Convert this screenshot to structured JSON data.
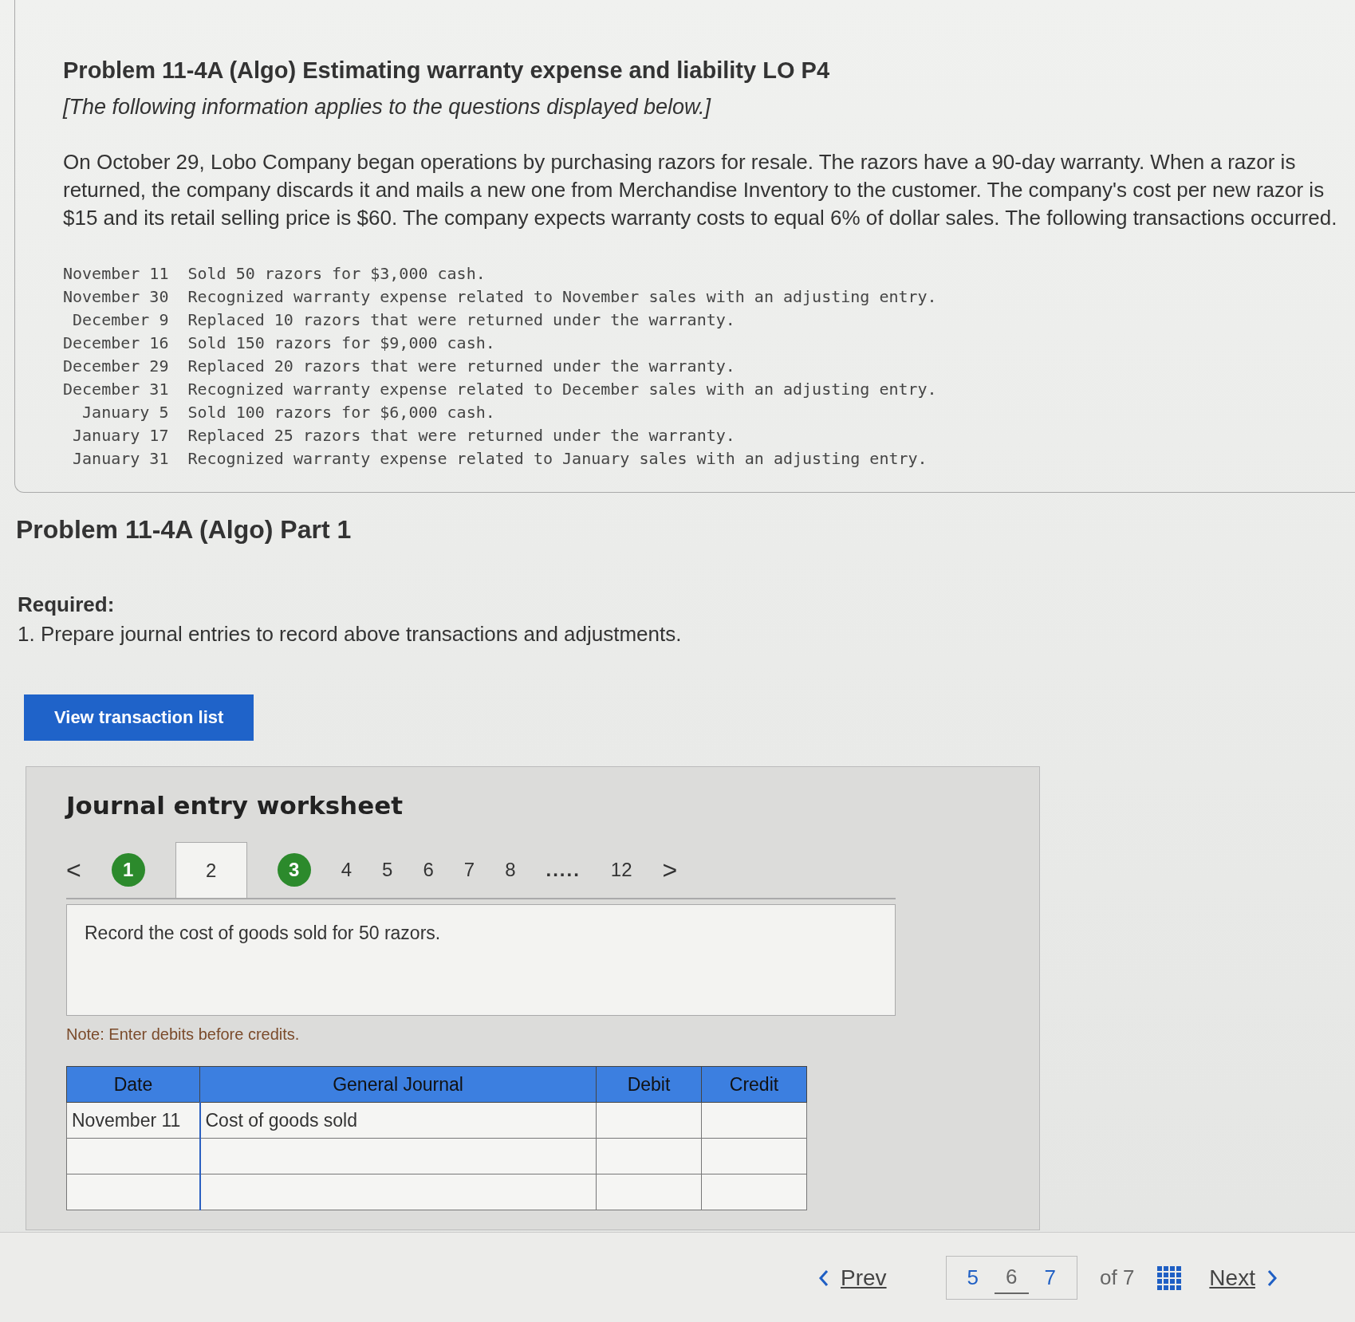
{
  "problem": {
    "title": "Problem 11-4A (Algo) Estimating warranty expense and liability LO P4",
    "note": "[The following information applies to the questions displayed below.]",
    "intro": "On October 29, Lobo Company began operations by purchasing razors for resale. The razors have a 90-day warranty. When a razor is returned, the company discards it and mails a new one from Merchandise Inventory to the customer. The company's cost per new razor is $15 and its retail selling price is $60. The company expects warranty costs to equal 6% of dollar sales. The following transactions occurred.",
    "transactions": [
      {
        "date": "November 11",
        "text": "Sold 50 razors for $3,000 cash."
      },
      {
        "date": "November 30",
        "text": "Recognized warranty expense related to November sales with an adjusting entry."
      },
      {
        "date": "December 9",
        "text": "Replaced 10 razors that were returned under the warranty."
      },
      {
        "date": "December 16",
        "text": "Sold 150 razors for $9,000 cash."
      },
      {
        "date": "December 29",
        "text": "Replaced 20 razors that were returned under the warranty."
      },
      {
        "date": "December 31",
        "text": "Recognized warranty expense related to December sales with an adjusting entry."
      },
      {
        "date": "January 5",
        "text": "Sold 100 razors for $6,000 cash."
      },
      {
        "date": "January 17",
        "text": "Replaced 25 razors that were returned under the warranty."
      },
      {
        "date": "January 31",
        "text": "Recognized warranty expense related to January sales with an adjusting entry."
      }
    ]
  },
  "part": {
    "title": "Problem 11-4A (Algo) Part 1",
    "required": "Required:",
    "instruction": "1. Prepare journal entries to record above transactions and adjustments."
  },
  "view_button": "View transaction list",
  "worksheet": {
    "title": "Journal entry worksheet",
    "prev": "<",
    "next": ">",
    "tabs": [
      {
        "kind": "page",
        "label": "1",
        "selected": false,
        "done": true
      },
      {
        "kind": "page",
        "label": "2",
        "selected": true,
        "done": false
      },
      {
        "kind": "page",
        "label": "3",
        "selected": false,
        "done": true
      },
      {
        "kind": "page",
        "label": "4",
        "selected": false,
        "done": false
      },
      {
        "kind": "page",
        "label": "5",
        "selected": false,
        "done": false
      },
      {
        "kind": "page",
        "label": "6",
        "selected": false,
        "done": false
      },
      {
        "kind": "page",
        "label": "7",
        "selected": false,
        "done": false
      },
      {
        "kind": "page",
        "label": "8",
        "selected": false,
        "done": false
      },
      {
        "kind": "ellipsis",
        "label": "....."
      },
      {
        "kind": "page",
        "label": "12",
        "selected": false,
        "done": false
      }
    ],
    "prompt": "Record the cost of goods sold for 50 razors.",
    "note": "Note: Enter debits before credits.",
    "columns": [
      "Date",
      "General Journal",
      "Debit",
      "Credit"
    ],
    "rows": [
      {
        "kind": "entry",
        "date": "November 11",
        "account": "Cost of goods sold"
      },
      {
        "kind": "blank"
      },
      {
        "kind": "blank"
      }
    ]
  },
  "pager": {
    "prev": "Prev",
    "pages": [
      {
        "label": "5",
        "selected": false
      },
      {
        "label": "6",
        "selected": true
      },
      {
        "label": "7",
        "selected": false
      }
    ],
    "of": "of 7",
    "next": "Next"
  }
}
